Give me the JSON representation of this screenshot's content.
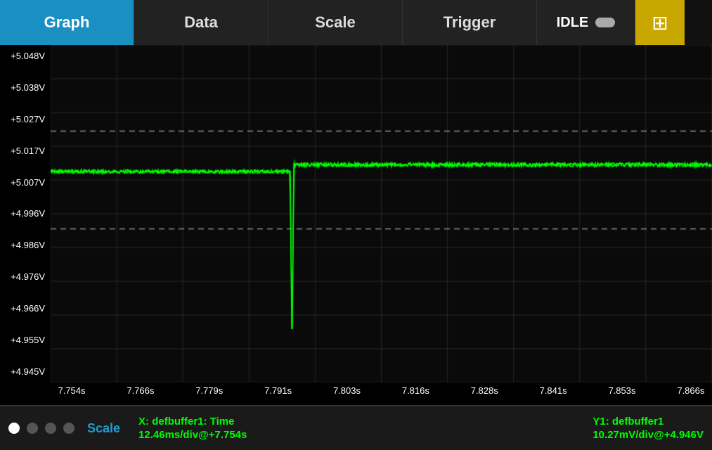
{
  "header": {
    "tabs": [
      {
        "label": "Graph",
        "active": true
      },
      {
        "label": "Data",
        "active": false
      },
      {
        "label": "Scale",
        "active": false
      },
      {
        "label": "Trigger",
        "active": false
      }
    ],
    "idle_label": "IDLE",
    "move_icon": "⊕"
  },
  "graph": {
    "y_labels": [
      "+5.048V",
      "+5.038V",
      "+5.027V",
      "+5.017V",
      "+5.007V",
      "+4.996V",
      "+4.986V",
      "+4.976V",
      "+4.966V",
      "+4.955V",
      "+4.945V"
    ],
    "x_labels": [
      "7.754s",
      "7.766s",
      "7.779s",
      "7.791s",
      "7.803s",
      "7.816s",
      "7.828s",
      "7.841s",
      "7.853s",
      "7.866s"
    ],
    "trigger_color": "#00cc00",
    "signal_color": "#00ff00",
    "grid_color": "rgba(255,255,255,0.15)",
    "dashed_line_color": "rgba(255,255,255,0.5)"
  },
  "footer": {
    "scale_label": "Scale",
    "x_title": "X: defbuffer1: Time",
    "x_value": "12.46ms/div@+7.754s",
    "y_title": "Y1: defbuffer1",
    "y_value": "10.27mV/div@+4.946V",
    "dots": [
      {
        "white": true
      },
      {
        "white": false
      },
      {
        "white": false
      },
      {
        "white": false
      }
    ]
  }
}
